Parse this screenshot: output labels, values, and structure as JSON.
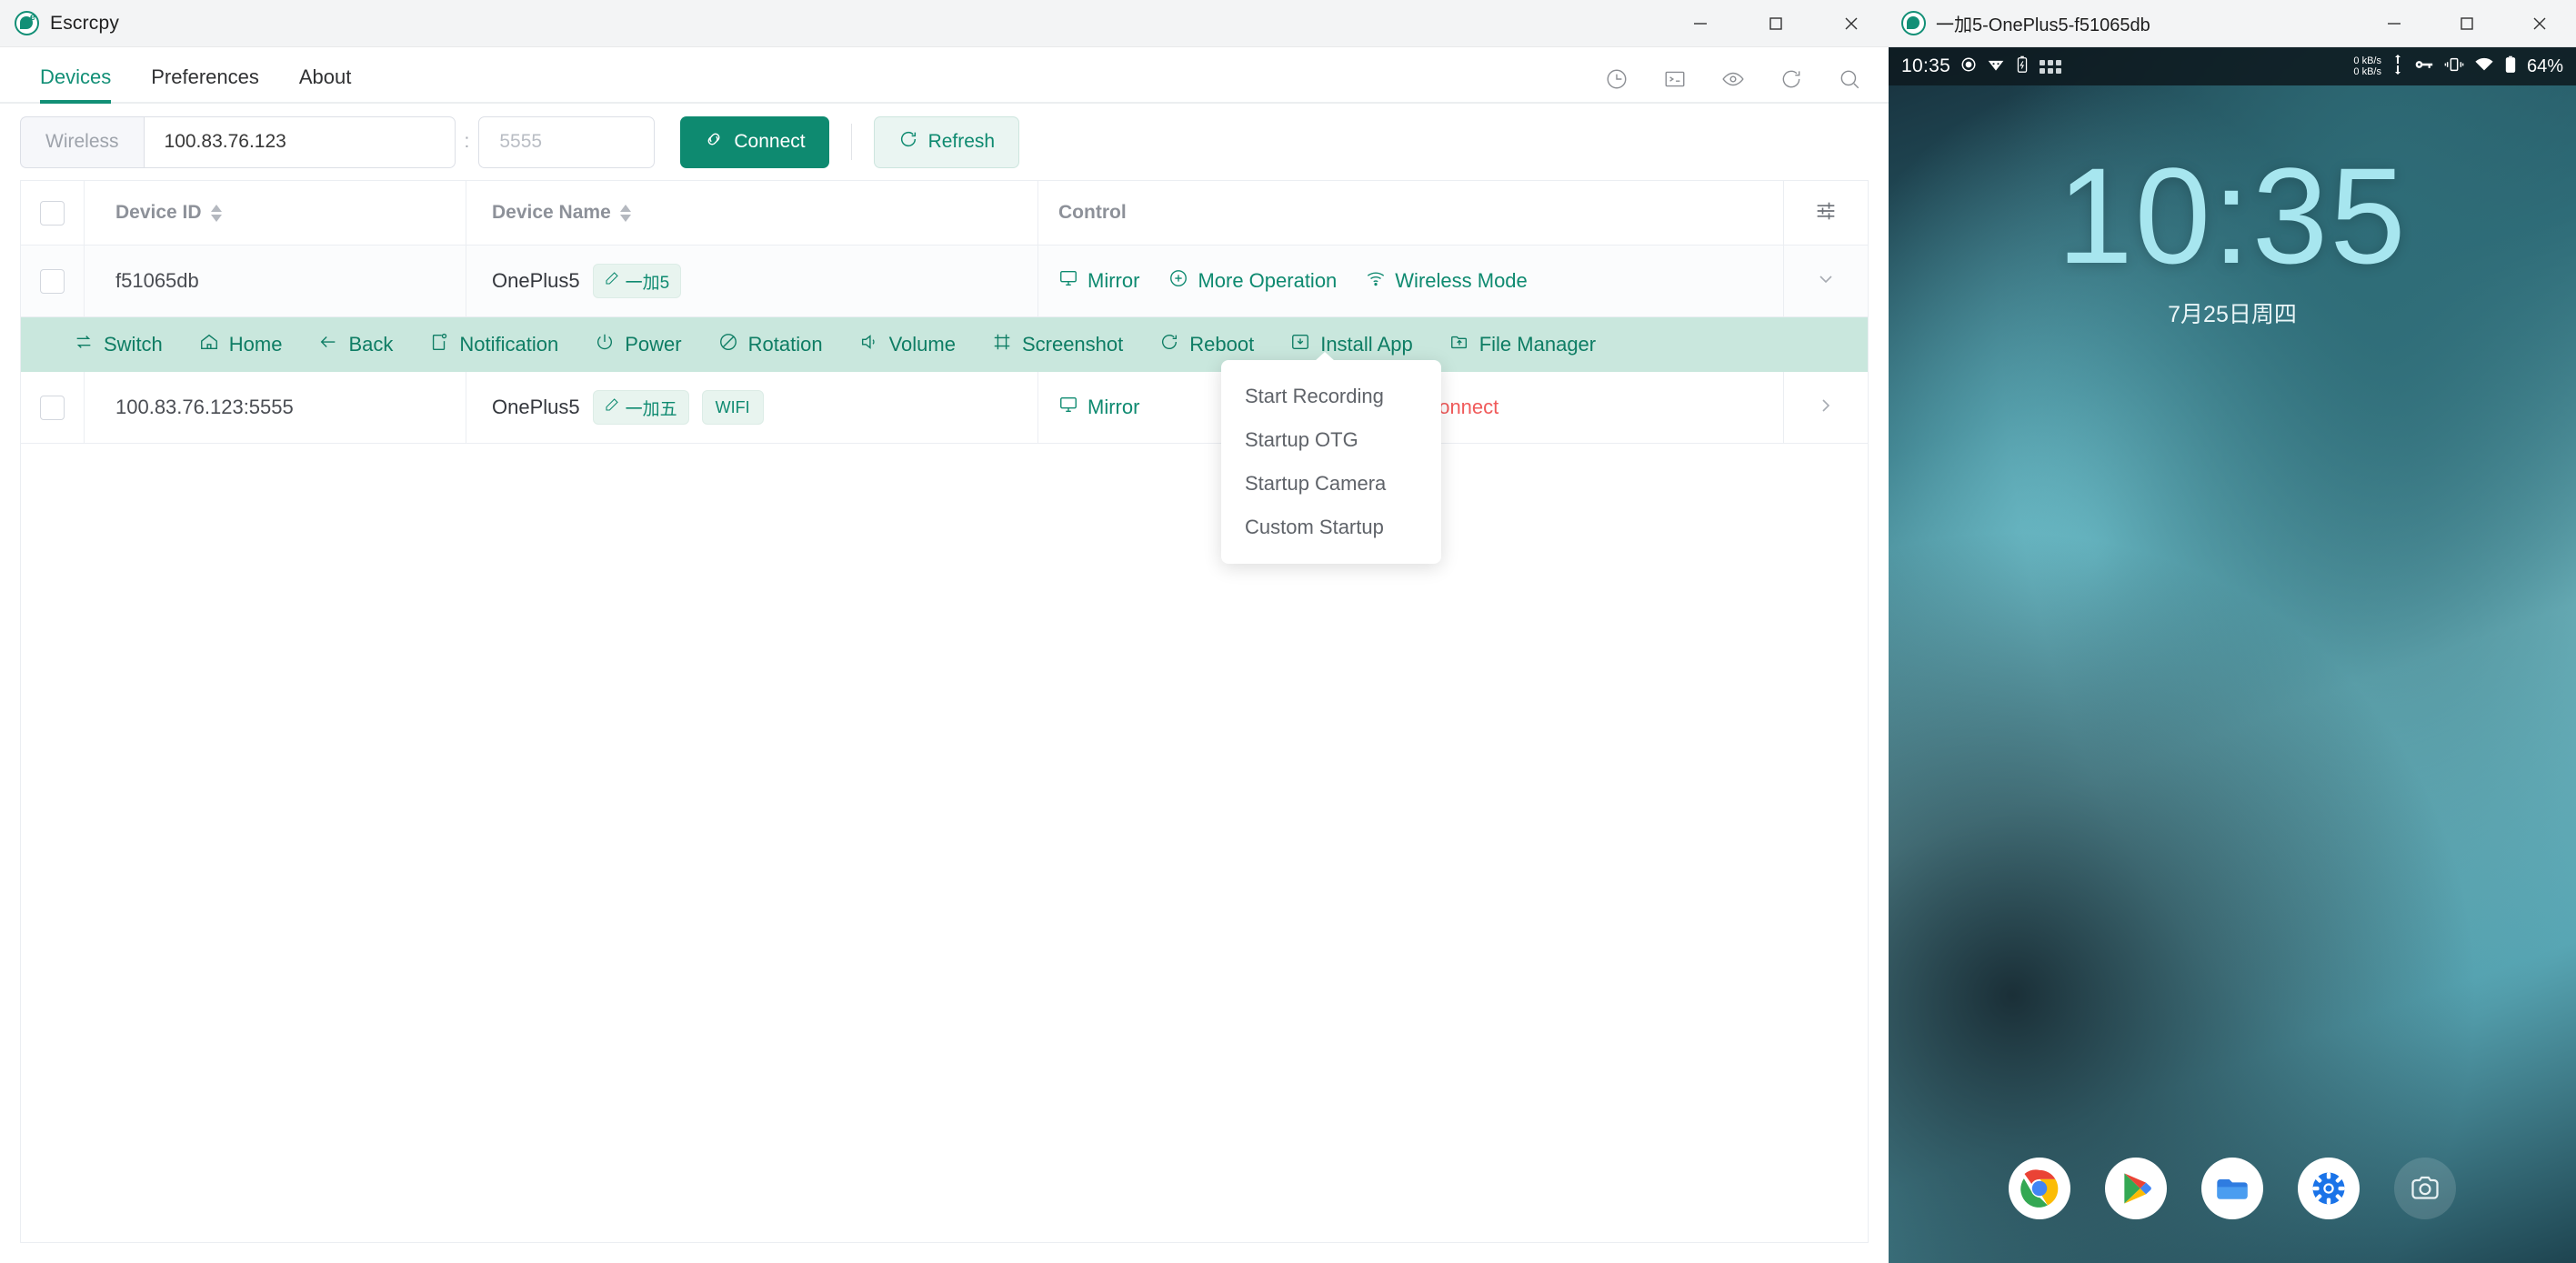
{
  "escrcpy_window": {
    "title": "Escrcpy",
    "app_icon": "escrcpy-logo-icon",
    "window_controls": {
      "minimize": "minimize-icon",
      "maximize": "maximize-icon",
      "close": "close-icon"
    },
    "tabs": [
      {
        "label": "Devices",
        "active": true
      },
      {
        "label": "Preferences",
        "active": false
      },
      {
        "label": "About",
        "active": false
      }
    ],
    "tab_icons": [
      "history-icon",
      "terminal-icon",
      "eye-icon",
      "refresh-icon",
      "search-icon"
    ],
    "connect_bar": {
      "prepend_label": "Wireless",
      "host_value": "100.83.76.123",
      "host_placeholder": "",
      "separator": ":",
      "port_value": "",
      "port_placeholder": "5555",
      "connect_label": "Connect",
      "connect_icon": "link-icon",
      "refresh_label": "Refresh",
      "refresh_icon": "refresh-icon"
    },
    "table": {
      "columns": [
        {
          "key": "device_id",
          "label": "Device ID",
          "sortable": true
        },
        {
          "key": "device_name",
          "label": "Device Name",
          "sortable": true
        },
        {
          "key": "control",
          "label": "Control",
          "sortable": false
        }
      ],
      "settings_icon": "column-settings-icon",
      "rows": [
        {
          "device_id": "f51065db",
          "device_name": "OnePlus5",
          "alias_badge": "一加5",
          "alias_icon": "edit-pencil-icon",
          "wifi_badge": null,
          "controls": [
            {
              "label": "Mirror",
              "icon": "monitor-icon",
              "style": "primary"
            },
            {
              "label": "More Operation",
              "icon": "plus-circle-icon",
              "style": "primary"
            },
            {
              "label": "Wireless Mode",
              "icon": "wifi-icon",
              "style": "primary"
            }
          ],
          "expand_icon": "chevron-down-icon",
          "expanded": true
        },
        {
          "device_id": "100.83.76.123:5555",
          "device_name": "OnePlus5",
          "alias_badge": "一加五",
          "alias_icon": "edit-pencil-icon",
          "wifi_badge": "WIFI",
          "controls": [
            {
              "label": "Mirror",
              "icon": "monitor-icon",
              "style": "primary"
            },
            {
              "label": "Disconnect",
              "icon": "close-circle-icon",
              "style": "danger"
            }
          ],
          "expand_icon": "chevron-right-icon",
          "expanded": false
        }
      ]
    },
    "action_strip": [
      {
        "label": "Switch",
        "icon": "switch-icon"
      },
      {
        "label": "Home",
        "icon": "home-icon"
      },
      {
        "label": "Back",
        "icon": "arrow-left-icon"
      },
      {
        "label": "Notification",
        "icon": "notification-icon"
      },
      {
        "label": "Power",
        "icon": "power-icon"
      },
      {
        "label": "Rotation",
        "icon": "rotation-icon"
      },
      {
        "label": "Volume",
        "icon": "volume-icon"
      },
      {
        "label": "Screenshot",
        "icon": "screenshot-icon"
      },
      {
        "label": "Reboot",
        "icon": "reboot-icon"
      },
      {
        "label": "Install App",
        "icon": "install-app-icon"
      },
      {
        "label": "File Manager",
        "icon": "file-manager-icon"
      }
    ],
    "dropdown_menu": {
      "open": true,
      "items": [
        "Start Recording",
        "Startup OTG",
        "Startup Camera",
        "Custom Startup"
      ]
    }
  },
  "android_window": {
    "title": "一加5-OnePlus5-f51065db",
    "app_icon": "escrcpy-logo-icon",
    "window_controls": {
      "minimize": "minimize-icon",
      "maximize": "maximize-icon",
      "close": "close-icon"
    },
    "status_bar": {
      "time": "10:35",
      "left_icons": [
        "record-dot-icon",
        "wifi-triangle-icon",
        "battery-charging-icon",
        "app-grid-icon"
      ],
      "net_up": "0 kB/s",
      "net_down": "0 kB/s",
      "right_icons": [
        "vpn-key-icon",
        "vibrate-icon",
        "wifi-icon",
        "battery-icon"
      ],
      "battery_percent": "64%"
    },
    "lockscreen": {
      "time": "10:35",
      "date": "7月25日周四"
    },
    "dock_apps": [
      "chrome-icon",
      "play-store-icon",
      "files-icon",
      "settings-icon",
      "camera-icon"
    ]
  },
  "colors": {
    "accent": "#0e8a70",
    "accent_light": "#c9e7dd",
    "danger": "#f05a5a",
    "header_text": "#8d9199",
    "clock": "#a7e6ef"
  }
}
